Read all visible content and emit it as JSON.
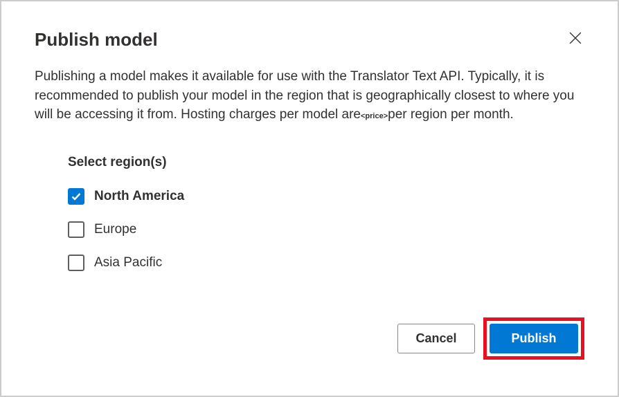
{
  "dialog": {
    "title": "Publish model",
    "description_pre": "Publishing a model makes it available for use with the Translator Text API. Typically, it is recommended to publish your model in the region that is geographically closest to where you will be accessing it from. Hosting charges per model are",
    "price_token": "<price>",
    "description_post": "per region per month."
  },
  "regions": {
    "section_title": "Select region(s)",
    "items": [
      {
        "label": "North America",
        "checked": true
      },
      {
        "label": "Europe",
        "checked": false
      },
      {
        "label": "Asia Pacific",
        "checked": false
      }
    ]
  },
  "footer": {
    "cancel_label": "Cancel",
    "publish_label": "Publish"
  },
  "colors": {
    "primary": "#0078d4",
    "highlight": "#e81123"
  }
}
